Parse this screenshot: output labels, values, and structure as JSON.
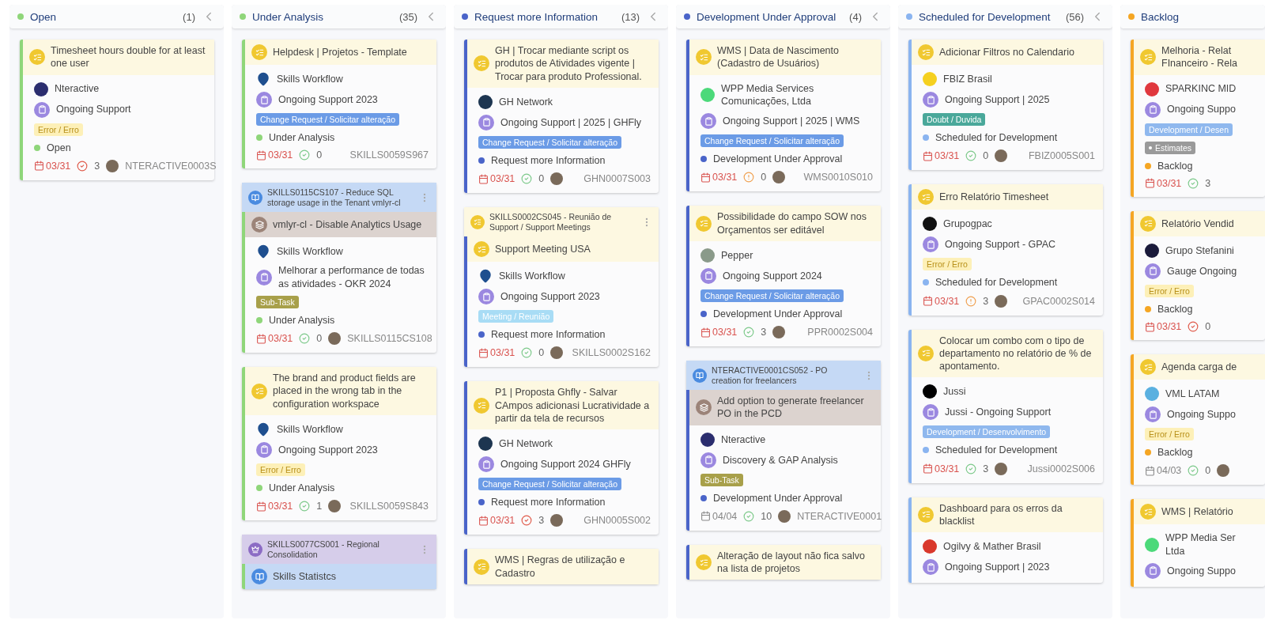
{
  "columns": [
    {
      "title": "Open",
      "count": "(1)",
      "color": "#8fd67a",
      "cards": [
        {
          "title": {
            "kind": "task",
            "text": "Timesheet hours double for at least one user"
          },
          "client": {
            "kind": "logo",
            "name": "Nteractive",
            "color": "#2b2d6e"
          },
          "project": "Ongoing Support",
          "tags": [
            {
              "label": "Error / Erro",
              "color": "#fdf0b8"
            }
          ],
          "status": "Open",
          "due": "03/31",
          "overdue": true,
          "effort": {
            "kind": "late",
            "value": "3"
          },
          "assignee": true,
          "id": "NTERACTIVE0003S"
        }
      ]
    },
    {
      "title": "Under Analysis",
      "count": "(35)",
      "color": "#8fd67a",
      "cards": [
        {
          "title": {
            "kind": "task",
            "text": "Helpdesk | Projetos - Template"
          },
          "client": {
            "kind": "pin",
            "name": "Skills Workflow",
            "color": "#1f4f8f"
          },
          "project": "Ongoing Support 2023",
          "tags": [
            {
              "label": "Change Request / Solicitar alteração",
              "color": "#6b9be6"
            }
          ],
          "status": "Under Analysis",
          "due": "03/31",
          "overdue": true,
          "effort": {
            "kind": "ok",
            "value": "0"
          },
          "assignee": false,
          "id": "SKILLS0059S967"
        },
        {
          "parent": {
            "kind": "story",
            "text": "SKILLS0115CS107 - Reduce SQL storage usage in the Tenant vmlyr-cl"
          },
          "title": {
            "kind": "subtask",
            "text": "vmlyr-cl - Disable Analytics Usage"
          },
          "client": {
            "kind": "pin",
            "name": "Skills Workflow",
            "color": "#1f4f8f"
          },
          "project": "Melhorar a performance de todas as atividades - OKR 2024",
          "tags": [
            {
              "label": "Sub-Task",
              "color": "#a8a04a"
            }
          ],
          "status": "Under Analysis",
          "due": "03/31",
          "overdue": true,
          "effort": {
            "kind": "ok",
            "value": "0"
          },
          "assignee": true,
          "id": "SKILLS0115CS108"
        },
        {
          "title": {
            "kind": "task",
            "text": "The brand and product fields are placed in the wrong tab in the configuration workspace"
          },
          "client": {
            "kind": "pin",
            "name": "Skills Workflow",
            "color": "#1f4f8f"
          },
          "project": "Ongoing Support 2023",
          "tags": [
            {
              "label": "Error / Erro",
              "color": "#fdf0b8"
            }
          ],
          "status": "Under Analysis",
          "due": "03/31",
          "overdue": true,
          "effort": {
            "kind": "ok",
            "value": "1"
          },
          "assignee": true,
          "id": "SKILLS0059S843"
        },
        {
          "parent": {
            "kind": "epic",
            "text": "SKILLS0077CS001 - Regional Consolidation"
          },
          "title": {
            "kind": "story",
            "text": "Skills Statistcs"
          }
        }
      ]
    },
    {
      "title": "Request more Information",
      "count": "(13)",
      "color": "#4a64c9",
      "cards": [
        {
          "title": {
            "kind": "task",
            "text": "GH | Trocar mediante script os produtos de Atividades vigente | Trocar para produto Professional."
          },
          "client": {
            "kind": "logo",
            "name": "GH Network",
            "color": "#1d3550"
          },
          "project": "Ongoing Support | 2025 | GHFly",
          "tags": [
            {
              "label": "Change Request / Solicitar alteração",
              "color": "#6b9be6"
            }
          ],
          "status": "Request more Information",
          "due": "03/31",
          "overdue": true,
          "effort": {
            "kind": "ok",
            "value": "0"
          },
          "assignee": true,
          "id": "GHN0007S003"
        },
        {
          "parent": {
            "kind": "task",
            "text": "SKILLS0002CS045 - Reunião de Support / Support Meetings"
          },
          "title": {
            "kind": "task",
            "text": "Support Meeting USA"
          },
          "client": {
            "kind": "pin",
            "name": "Skills Workflow",
            "color": "#1f4f8f"
          },
          "project": "Ongoing Support 2023",
          "tags": [
            {
              "label": "Meeting / Reunião",
              "color": "#a8dcf5"
            }
          ],
          "status": "Request more Information",
          "due": "03/31",
          "overdue": true,
          "effort": {
            "kind": "ok",
            "value": "0"
          },
          "assignee": true,
          "id": "SKILLS0002S162"
        },
        {
          "title": {
            "kind": "task",
            "text": "P1 | Proposta Ghfly - Salvar CAmpos adicionasi Lucratividade a partir da tela de recursos"
          },
          "client": {
            "kind": "logo",
            "name": "GH Network",
            "color": "#1d3550"
          },
          "project": "Ongoing Support 2024 GHFly",
          "tags": [
            {
              "label": "Change Request / Solicitar alteração",
              "color": "#6b9be6"
            }
          ],
          "status": "Request more Information",
          "due": "03/31",
          "overdue": true,
          "effort": {
            "kind": "late",
            "value": "3"
          },
          "assignee": true,
          "id": "GHN0005S002"
        },
        {
          "title": {
            "kind": "task",
            "text": "WMS | Regras de utilização e Cadastro"
          }
        }
      ]
    },
    {
      "title": "Development Under Approval",
      "count": "(4)",
      "color": "#4a64c9",
      "cards": [
        {
          "title": {
            "kind": "task",
            "text": "WMS | Data de Nascimento (Cadastro de Usuários)"
          },
          "client": {
            "kind": "logo",
            "name": "WPP Media Services Comunicações, Ltda",
            "color": "#4cd97a"
          },
          "project": "Ongoing Support | 2025 | WMS",
          "tags": [
            {
              "label": "Change Request / Solicitar alteração",
              "color": "#6b9be6"
            }
          ],
          "status": "Development Under Approval",
          "due": "03/31",
          "overdue": true,
          "effort": {
            "kind": "warn",
            "value": "0"
          },
          "assignee": true,
          "id": "WMS0010S010"
        },
        {
          "title": {
            "kind": "task",
            "text": "Possibilidade do campo SOW nos Orçamentos ser editável"
          },
          "client": {
            "kind": "logo",
            "name": "Pepper",
            "color": "#8a9a8a"
          },
          "project": "Ongoing Support 2024",
          "tags": [
            {
              "label": "Change Request / Solicitar alteração",
              "color": "#6b9be6"
            }
          ],
          "status": "Development Under Approval",
          "due": "03/31",
          "overdue": true,
          "effort": {
            "kind": "ok",
            "value": "3"
          },
          "assignee": true,
          "id": "PPR0002S004"
        },
        {
          "parent": {
            "kind": "story",
            "text": "NTERACTIVE0001CS052 - PO creation for freelancers"
          },
          "title": {
            "kind": "subtask",
            "text": "Add option to generate freelancer PO in the PCD"
          },
          "client": {
            "kind": "logo",
            "name": "Nteractive",
            "color": "#2b2d6e"
          },
          "project": "Discovery & GAP Analysis",
          "tags": [
            {
              "label": "Sub-Task",
              "color": "#a8a04a"
            }
          ],
          "status": "Development Under Approval",
          "due": "04/04",
          "overdue": false,
          "effort": {
            "kind": "ok",
            "value": "10"
          },
          "assignee": true,
          "id": "NTERACTIVE0001"
        },
        {
          "title": {
            "kind": "task",
            "text": "Alteração de layout não fica salvo na lista de projetos"
          }
        }
      ]
    },
    {
      "title": "Scheduled for Development",
      "count": "(56)",
      "color": "#8ab4f0",
      "cards": [
        {
          "title": {
            "kind": "task",
            "text": "Adicionar Filtros no Calendario"
          },
          "client": {
            "kind": "logo",
            "name": "FBIZ Brasil",
            "color": "#f5d020"
          },
          "project": "Ongoing Support | 2025",
          "tags": [
            {
              "label": "Doubt / Duvida",
              "color": "#4aa89a"
            }
          ],
          "status": "Scheduled for Development",
          "due": "03/31",
          "overdue": true,
          "effort": {
            "kind": "ok",
            "value": "0"
          },
          "assignee": true,
          "id": "FBIZ0005S001"
        },
        {
          "title": {
            "kind": "task",
            "text": "Erro Relatório Timesheet"
          },
          "client": {
            "kind": "logo",
            "name": "Grupogpac",
            "color": "#111111"
          },
          "project": "Ongoing Support - GPAC",
          "tags": [
            {
              "label": "Error / Erro",
              "color": "#fdf0b8"
            }
          ],
          "status": "Scheduled for Development",
          "due": "03/31",
          "overdue": true,
          "effort": {
            "kind": "warn",
            "value": "3"
          },
          "assignee": true,
          "id": "GPAC0002S014"
        },
        {
          "title": {
            "kind": "task",
            "text": "Colocar um combo com o tipo de departamento no relatório de % de apontamento."
          },
          "client": {
            "kind": "logo",
            "name": "Jussi",
            "color": "#000000"
          },
          "project": "Jussi - Ongoing Support",
          "tags": [
            {
              "label": "Development / Desenvolvimento",
              "color": "#8fb8ee"
            }
          ],
          "status": "Scheduled for Development",
          "due": "03/31",
          "overdue": true,
          "effort": {
            "kind": "ok",
            "value": "3"
          },
          "assignee": true,
          "id": "Jussi0002S006"
        },
        {
          "title": {
            "kind": "task",
            "text": "Dashboard para os erros da blacklist"
          },
          "client": {
            "kind": "logo",
            "name": "Ogilvy & Mather Brasil",
            "color": "#d9382c"
          },
          "project": "Ongoing Support | 2023"
        }
      ]
    },
    {
      "title": "Backlog",
      "color": "#f5a623",
      "cards": [
        {
          "title": {
            "kind": "task",
            "text": "Melhoria - Relat\nFInanceiro - Rela"
          },
          "client": {
            "kind": "logo",
            "name": "SPARKINC MID",
            "color": "#e0383e"
          },
          "project": "Ongoing Suppo",
          "tags": [
            {
              "label": "Development / Desen",
              "color": "#8fb8ee"
            },
            {
              "label": "Estimates",
              "color": "#9a9a9a",
              "dot": true
            }
          ],
          "status": "Backlog",
          "due": "03/31",
          "overdue": true,
          "effort": {
            "kind": "ok",
            "value": "3"
          },
          "assignee": false
        },
        {
          "title": {
            "kind": "task",
            "text": "Relatório Vendid"
          },
          "client": {
            "kind": "logo",
            "name": "Grupo Stefanini",
            "color": "#1a1a3a"
          },
          "project": "Gauge Ongoing",
          "tags": [
            {
              "label": "Error / Erro",
              "color": "#fdf0b8"
            }
          ],
          "status": "Backlog",
          "due": "03/31",
          "overdue": true,
          "effort": {
            "kind": "late",
            "value": "0"
          },
          "assignee": false
        },
        {
          "title": {
            "kind": "task",
            "text": "Agenda carga de"
          },
          "client": {
            "kind": "logo",
            "name": "VML LATAM",
            "color": "#5ab0e0"
          },
          "project": "Ongoing Suppo",
          "tags": [
            {
              "label": "Error / Erro",
              "color": "#fdf0b8"
            }
          ],
          "status": "Backlog",
          "due": "04/03",
          "overdue": false,
          "effort": {
            "kind": "ok",
            "value": "0"
          },
          "assignee": true
        },
        {
          "title": {
            "kind": "task",
            "text": "WMS | Relatório"
          },
          "client": {
            "kind": "logo",
            "name": "WPP Media Ser\nLtda",
            "color": "#4cd97a"
          },
          "project": "Ongoing Suppo"
        }
      ]
    }
  ]
}
